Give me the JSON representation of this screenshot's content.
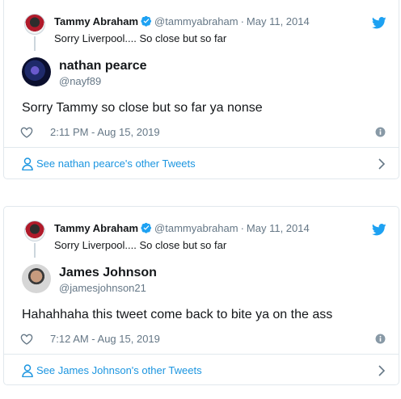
{
  "tweets": [
    {
      "quoted": {
        "name": "Tammy Abraham",
        "handle": "@tammyabraham",
        "separator": "·",
        "date": "May 11, 2014",
        "text": "Sorry Liverpool.... So close but so far"
      },
      "reply": {
        "name": "nathan pearce",
        "handle": "@nayf89",
        "text": "Sorry Tammy so close but so far ya nonse",
        "timestamp": "2:11 PM - Aug 15, 2019"
      },
      "see_more": "See nathan pearce's other Tweets"
    },
    {
      "quoted": {
        "name": "Tammy Abraham",
        "handle": "@tammyabraham",
        "separator": "·",
        "date": "May 11, 2014",
        "text": "Sorry Liverpool.... So close but so far"
      },
      "reply": {
        "name": "James Johnson",
        "handle": "@jamesjohnson21",
        "text": "Hahahhaha this tweet come back to bite ya on the ass",
        "timestamp": "7:12 AM - Aug 15, 2019"
      },
      "see_more": "See James Johnson's other Tweets"
    }
  ],
  "icons": {
    "brand": "twitter-bird-icon",
    "verified": "verified-badge-icon",
    "like": "heart-icon",
    "info": "info-icon",
    "profile": "person-icon",
    "more": "chevron-right-icon"
  },
  "colors": {
    "twitter_blue": "#1da1f2",
    "link_blue": "#1b95e0",
    "secondary_text": "#657786",
    "border": "#e1e8ed"
  }
}
